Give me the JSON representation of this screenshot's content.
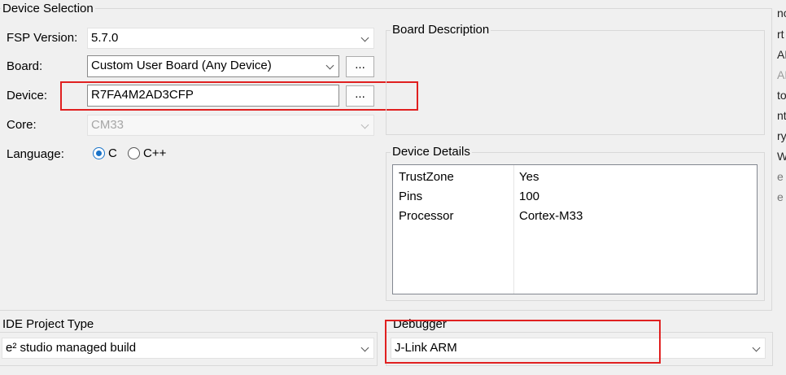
{
  "device_selection": {
    "title": "Device Selection",
    "fsp_version": {
      "label": "FSP Version:",
      "value": "5.7.0"
    },
    "board": {
      "label": "Board:",
      "value": "Custom User Board (Any Device)",
      "button": "..."
    },
    "device": {
      "label": "Device:",
      "value": "R7FA4M2AD3CFP",
      "button": "..."
    },
    "core": {
      "label": "Core:",
      "value": "CM33"
    },
    "language": {
      "label": "Language:",
      "options": [
        "C",
        "C++"
      ],
      "selected": "C"
    }
  },
  "board_description": {
    "title": "Board Description"
  },
  "device_details": {
    "title": "Device Details",
    "rows": [
      {
        "key": "TrustZone",
        "value": "Yes"
      },
      {
        "key": "Pins",
        "value": "100"
      },
      {
        "key": "Processor",
        "value": "Cortex-M33"
      }
    ]
  },
  "ide_project_type": {
    "title": "IDE Project Type",
    "value": "e² studio managed build"
  },
  "debugger": {
    "title": "Debugger",
    "value": "J-Link ARM"
  },
  "side_fragments": [
    "nc",
    "rt",
    "AF",
    "AF",
    "to",
    "nt",
    "ry",
    "W",
    "e",
    "e"
  ],
  "colors": {
    "highlight": "#e02020",
    "accent": "#1a73c8"
  }
}
